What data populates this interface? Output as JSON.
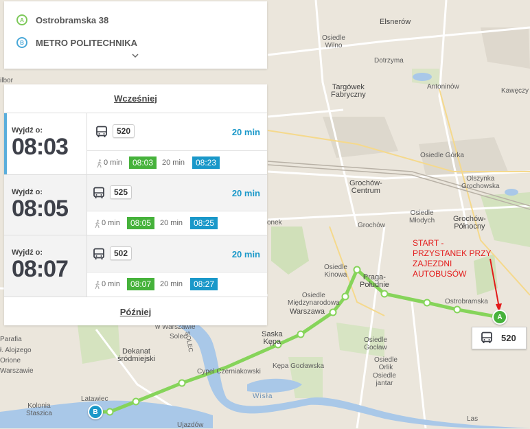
{
  "route": {
    "start_badge": "A",
    "start_name": "Ostrobramska 38",
    "end_badge": "B",
    "end_name": "METRO POLITECHNIKA"
  },
  "departures_panel": {
    "earlier_label": "Wcześniej",
    "later_label": "Później",
    "items": [
      {
        "leave_label": "Wyjdź o:",
        "time": "08:03",
        "line": "520",
        "duration": "20 min",
        "walk": "0 min",
        "depart": "08:03",
        "ride": "20 min",
        "arrive": "08:23"
      },
      {
        "leave_label": "Wyjdź o:",
        "time": "08:05",
        "line": "525",
        "duration": "20 min",
        "walk": "0 min",
        "depart": "08:05",
        "ride": "20 min",
        "arrive": "08:25"
      },
      {
        "leave_label": "Wyjdź o:",
        "time": "08:07",
        "line": "502",
        "duration": "20 min",
        "walk": "0 min",
        "depart": "08:07",
        "ride": "20 min",
        "arrive": "08:27"
      }
    ]
  },
  "map": {
    "markers": {
      "a": "A",
      "b": "B"
    },
    "bus_callout_line": "520",
    "annotation": "START - PRZYSTANEK PRZY ZAJEZDNI AUTOBUSÓW",
    "labels": {
      "elsnerow": "Elsnerów",
      "osiedle_wilno": "Osiedle\nWilno",
      "dotrzyma": "Dotrzyma",
      "antoninow": "Antoninów",
      "kaweczyn": "Kawęczy",
      "targowek": "Targówek\nFabryczny",
      "gorka": "Osiedle Górka",
      "olszynka": "Olszynka\nGrochowska",
      "grochow_centrum": "Grochów-\nCentrum",
      "osiedle_mlodych": "Osiedle\nMłodych",
      "grochow": "Grochów",
      "grochow_polnocny": "Grochów-\nPółnocny",
      "osiedle_kinowa": "Osiedle\nKinowa",
      "praga_poludnie": "Praga-\nPołudnie",
      "ostrobramska": "Ostrobramska",
      "osiedle_miedzynarodowa": "Osiedle\nMiędzynarodowa",
      "warszawa": "Warszawa",
      "w_warszawie": "w Warszawie",
      "solec": "Solec",
      "solec_street": "SOLEC",
      "saska": "Saska\nKępa",
      "dekanat": "Dekanat\nśródmiejski",
      "cypel": "Cypel Czerniakowski",
      "kepa_goclawska": "Kępa Gocławska",
      "goclaw": "Osiedle\nGocław",
      "orlik": "Osiedle\nOrlik",
      "jantar": "Osiedle\njantar",
      "wisla": "Wisła",
      "las": "Las",
      "parafia": "Parafia",
      "aloj": "ł. Alojzego",
      "orione": "Orione",
      "warszawie_left": "Warszawie",
      "kolonia": "Kolonia\nStaszica",
      "latawiec": "Latawiec",
      "ujazdow": "Ujazdów",
      "wilbor": "ilbor",
      "onek": "onek"
    }
  }
}
